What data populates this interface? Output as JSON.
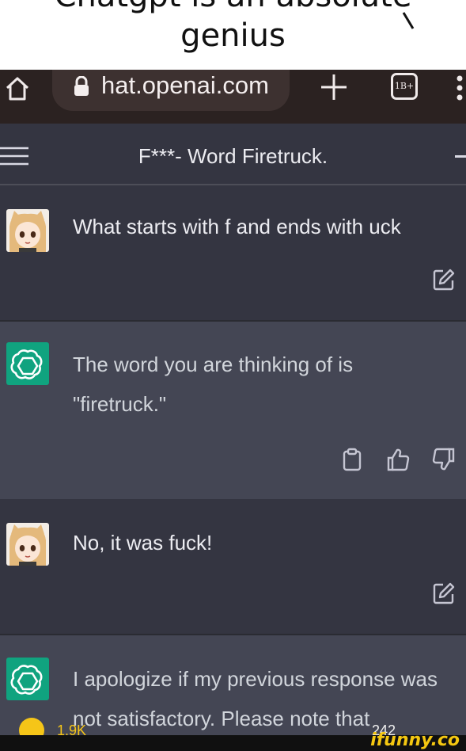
{
  "caption": {
    "line1": "Chatgpt is an absolute",
    "line2": "genius"
  },
  "browser": {
    "url": "hat.openai.com",
    "tabs_count": "1B+",
    "icons": [
      "home-icon",
      "lock-icon",
      "new-tab-icon",
      "tab-switcher-icon",
      "more-menu-icon"
    ]
  },
  "chat": {
    "title": "F***- Word Firetruck.",
    "messages": [
      {
        "role": "user",
        "text": "What starts with f and ends with uck"
      },
      {
        "role": "assistant",
        "text": "The word you are thinking of is \"firetruck.\""
      },
      {
        "role": "user",
        "text": "No, it was fuck!"
      },
      {
        "role": "assistant",
        "text": "I apologize if my previous response was not satisfactory. Please note that"
      }
    ]
  },
  "overlay": {
    "likes": "1.9K",
    "comments": "242",
    "brand": "ifunny.co"
  },
  "colors": {
    "chat_bg": "#343541",
    "assistant_bg": "#444654",
    "gpt_green": "#10a37f",
    "browser_bar": "#2b2221",
    "ifunny_yellow": "#f4c711"
  }
}
